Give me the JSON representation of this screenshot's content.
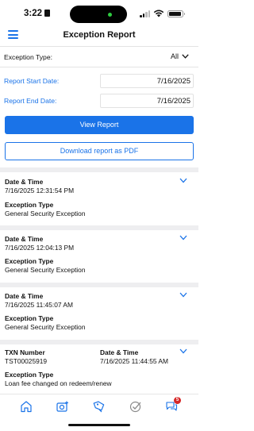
{
  "status": {
    "time": "3:22"
  },
  "header": {
    "title": "Exception Report"
  },
  "filters": {
    "exception_type_label": "Exception Type:",
    "exception_type_value": "All",
    "start_label": "Report Start Date:",
    "start_value": "7/16/2025",
    "end_label": "Report End Date:",
    "end_value": "7/16/2025"
  },
  "buttons": {
    "view": "View Report",
    "download": "Download report as PDF"
  },
  "cards": [
    {
      "datetime_label": "Date & Time",
      "datetime": "7/16/2025 12:31:54 PM",
      "type_label": "Exception Type",
      "type": "General Security Exception"
    },
    {
      "datetime_label": "Date & Time",
      "datetime": "7/16/2025 12:04:13 PM",
      "type_label": "Exception Type",
      "type": "General Security Exception"
    },
    {
      "datetime_label": "Date & Time",
      "datetime": "7/16/2025 11:45:07 AM",
      "type_label": "Exception Type",
      "type": "General Security Exception"
    },
    {
      "txn_label": "TXN Number",
      "txn": "TST00025919",
      "datetime_label": "Date & Time",
      "datetime": "7/16/2025 11:44:55 AM",
      "type_label": "Exception Type",
      "type": "Loan fee changed on redeem/renew"
    }
  ],
  "tabbar": {
    "notification_count": "5"
  },
  "colors": {
    "accent": "#1a73e8",
    "badge": "#d62828"
  },
  "icons": [
    "home-icon",
    "camera-icon",
    "tag-icon",
    "checkmark-icon",
    "chat-icon"
  ]
}
